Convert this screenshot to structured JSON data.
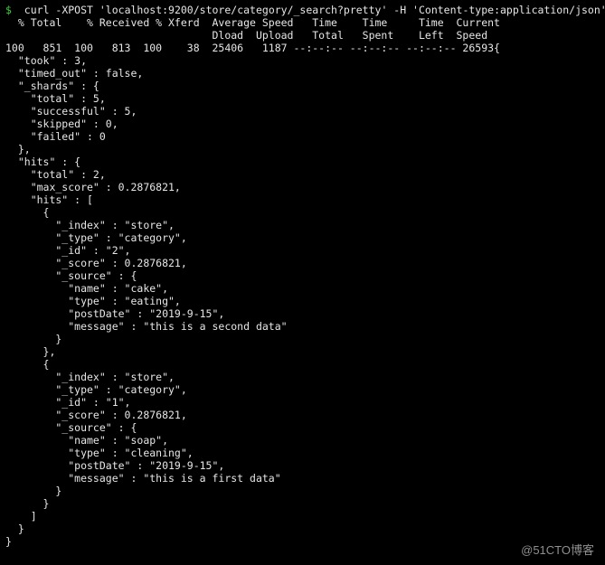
{
  "prompt": "$",
  "command": "curl -XPOST 'localhost:9200/store/category/_search?pretty' -H 'Content-type:application/json' -d'{\"query\":{\"match\":{\"message\":\"data\"}}}'",
  "curl_header": {
    "line1": "  % Total    % Received % Xferd  Average Speed   Time    Time     Time  Current",
    "line2": "                                 Dload  Upload   Total   Spent    Left  Speed",
    "line3": "100   851  100   813  100    38  25406   1187 --:--:-- --:--:-- --:--:-- 26593{"
  },
  "json_body": "  \"took\" : 3,\n  \"timed_out\" : false,\n  \"_shards\" : {\n    \"total\" : 5,\n    \"successful\" : 5,\n    \"skipped\" : 0,\n    \"failed\" : 0\n  },\n  \"hits\" : {\n    \"total\" : 2,\n    \"max_score\" : 0.2876821,\n    \"hits\" : [\n      {\n        \"_index\" : \"store\",\n        \"_type\" : \"category\",\n        \"_id\" : \"2\",\n        \"_score\" : 0.2876821,\n        \"_source\" : {\n          \"name\" : \"cake\",\n          \"type\" : \"eating\",\n          \"postDate\" : \"2019-9-15\",\n          \"message\" : \"this is a second data\"\n        }\n      },\n      {\n        \"_index\" : \"store\",\n        \"_type\" : \"category\",\n        \"_id\" : \"1\",\n        \"_score\" : 0.2876821,\n        \"_source\" : {\n          \"name\" : \"soap\",\n          \"type\" : \"cleaning\",\n          \"postDate\" : \"2019-9-15\",\n          \"message\" : \"this is a first data\"\n        }\n      }\n    ]\n  }\n}",
  "watermark": "@51CTO博客",
  "response_parsed": {
    "took": 3,
    "timed_out": false,
    "_shards": {
      "total": 5,
      "successful": 5,
      "skipped": 0,
      "failed": 0
    },
    "hits": {
      "total": 2,
      "max_score": 0.2876821,
      "hits": [
        {
          "_index": "store",
          "_type": "category",
          "_id": "2",
          "_score": 0.2876821,
          "_source": {
            "name": "cake",
            "type": "eating",
            "postDate": "2019-9-15",
            "message": "this is a second data"
          }
        },
        {
          "_index": "store",
          "_type": "category",
          "_id": "1",
          "_score": 0.2876821,
          "_source": {
            "name": "soap",
            "type": "cleaning",
            "postDate": "2019-9-15",
            "message": "this is a first data"
          }
        }
      ]
    }
  },
  "curl_stats": {
    "total_pct": 100,
    "total_bytes": 851,
    "received_pct": 100,
    "received_bytes": 813,
    "xferd_pct": 100,
    "xferd_bytes": 38,
    "avg_dload": 25406,
    "avg_upload": 1187,
    "time_total": "--:--:--",
    "time_spent": "--:--:--",
    "time_left": "--:--:--",
    "current_speed": 26593
  }
}
